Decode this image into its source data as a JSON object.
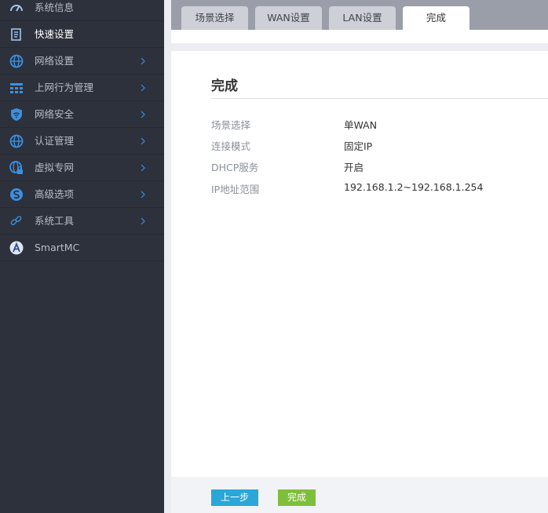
{
  "sidebar": {
    "items": [
      {
        "label": "系统信息",
        "icon": "speedometer-icon",
        "has_children": false
      },
      {
        "label": "快速设置",
        "icon": "document-icon",
        "has_children": false,
        "active": true
      },
      {
        "label": "网络设置",
        "icon": "globe-icon",
        "has_children": true
      },
      {
        "label": "上网行为管理",
        "icon": "grid-icon",
        "has_children": true
      },
      {
        "label": "网络安全",
        "icon": "shield-wifi-icon",
        "has_children": true
      },
      {
        "label": "认证管理",
        "icon": "globe-icon",
        "has_children": true
      },
      {
        "label": "虚拟专网",
        "icon": "globe-lock-icon",
        "has_children": true
      },
      {
        "label": "高级选项",
        "icon": "s-circle-icon",
        "has_children": true
      },
      {
        "label": "系统工具",
        "icon": "link-icon",
        "has_children": true
      },
      {
        "label": "SmartMC",
        "icon": "a-circle-icon",
        "has_children": false
      }
    ]
  },
  "tabs": [
    {
      "label": "场景选择",
      "active": false
    },
    {
      "label": "WAN设置",
      "active": false
    },
    {
      "label": "LAN设置",
      "active": false
    },
    {
      "label": "完成",
      "active": true
    }
  ],
  "content": {
    "title": "完成",
    "rows": [
      {
        "key": "场景选择",
        "value": "单WAN"
      },
      {
        "key": "连接模式",
        "value": "固定IP"
      },
      {
        "key": "DHCP服务",
        "value": "开启"
      },
      {
        "key": "IP地址范围",
        "value": "192.168.1.2~192.168.1.254"
      }
    ]
  },
  "footer": {
    "prev_label": "上一步",
    "done_label": "完成"
  },
  "colors": {
    "sidebar_bg": "#2c313b",
    "icon_blue": "#3d8fe0",
    "prev_button": "#2aa7d6",
    "done_button": "#7fbe3c"
  }
}
